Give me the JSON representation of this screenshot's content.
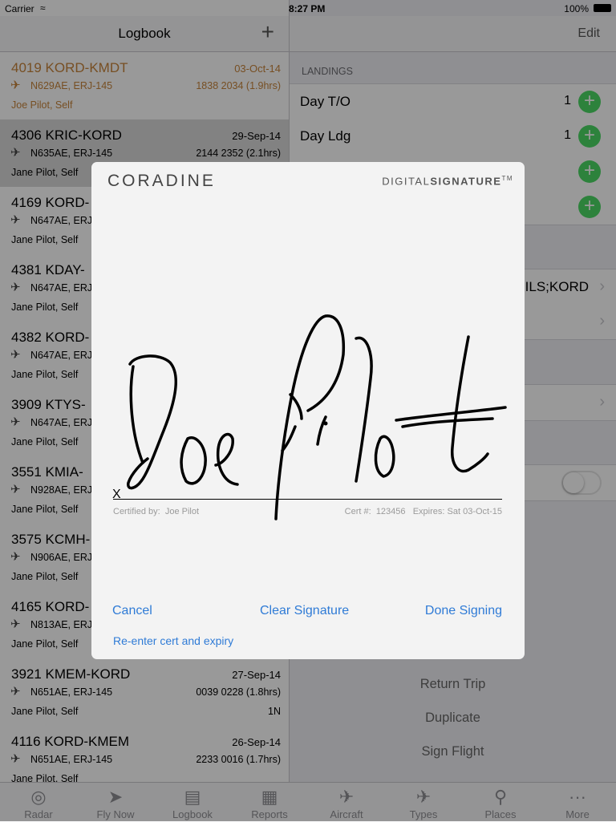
{
  "status": {
    "carrier": "Carrier",
    "time": "8:27 PM",
    "battery": "100%"
  },
  "left": {
    "title": "Logbook",
    "add": "+",
    "flights": [
      {
        "route": "4019 KORD-KMDT",
        "date": "03-Oct-14",
        "aircraft": "N629AE, ERJ-145",
        "times": "1838 2034 (1.9hrs)",
        "crew": "Joe Pilot, Self",
        "extra": ""
      },
      {
        "route": "4306 KRIC-KORD",
        "date": "29-Sep-14",
        "aircraft": "N635AE, ERJ-145",
        "times": "2144 2352 (2.1hrs)",
        "crew": "Jane Pilot, Self",
        "extra": ""
      },
      {
        "route": "4169 KORD-",
        "date": "",
        "aircraft": "N647AE, ERJ",
        "times": "",
        "crew": "Jane Pilot, Self",
        "extra": ""
      },
      {
        "route": "4381 KDAY-",
        "date": "",
        "aircraft": "N647AE, ERJ",
        "times": "",
        "crew": "Jane Pilot, Self",
        "extra": ""
      },
      {
        "route": "4382 KORD-",
        "date": "",
        "aircraft": "N647AE, ERJ",
        "times": "",
        "crew": "Jane Pilot, Self",
        "extra": ""
      },
      {
        "route": "3909 KTYS-",
        "date": "",
        "aircraft": "N647AE, ERJ",
        "times": "",
        "crew": "Jane Pilot, Self",
        "extra": ""
      },
      {
        "route": "3551 KMIA-",
        "date": "",
        "aircraft": "N928AE, ERJ",
        "times": "",
        "crew": "Jane Pilot, Self",
        "extra": ""
      },
      {
        "route": "3575 KCMH-",
        "date": "",
        "aircraft": "N906AE, ERJ",
        "times": "",
        "crew": "Jane Pilot, Self",
        "extra": ""
      },
      {
        "route": "4165 KORD-",
        "date": "",
        "aircraft": "N813AE, ERJ",
        "times": "",
        "crew": "Jane Pilot, Self",
        "extra": ""
      },
      {
        "route": "3921 KMEM-KORD",
        "date": "27-Sep-14",
        "aircraft": "N651AE, ERJ-145",
        "times": "0039 0228 (1.8hrs)",
        "crew": "Jane Pilot, Self",
        "extra": "1N"
      },
      {
        "route": "4116 KORD-KMEM",
        "date": "26-Sep-14",
        "aircraft": "N651AE, ERJ-145",
        "times": "2233 0016 (1.7hrs)",
        "crew": "Jane Pilot, Self",
        "extra": ""
      }
    ]
  },
  "right": {
    "edit": "Edit",
    "landings_header": "LANDINGS",
    "day_to": {
      "label": "Day T/O",
      "count": "1"
    },
    "day_ldg": {
      "label": "Day Ldg",
      "count": "1"
    },
    "approach_value": "ILS;KORD",
    "actions": [
      "Return Trip",
      "Duplicate",
      "Sign Flight"
    ]
  },
  "modal": {
    "brand": "CORADINE",
    "product_light": "DIGITAL",
    "product_bold": "SIGNATURE",
    "tm": "TM",
    "x": "X",
    "certified_label": "Certified by:",
    "certified_name": "Joe Pilot",
    "cert_label": "Cert #:",
    "cert_number": "123456",
    "expires_label": "Expires:",
    "expires_value": "Sat 03-Oct-15",
    "cancel": "Cancel",
    "clear": "Clear Signature",
    "done": "Done Signing",
    "reenter": "Re-enter cert and expiry"
  },
  "tabs": [
    {
      "label": "Radar",
      "icon": "radar-icon"
    },
    {
      "label": "Fly Now",
      "icon": "rocket-icon"
    },
    {
      "label": "Logbook",
      "icon": "logbook-icon"
    },
    {
      "label": "Reports",
      "icon": "reports-icon"
    },
    {
      "label": "Aircraft",
      "icon": "aircraft-icon"
    },
    {
      "label": "Types",
      "icon": "types-icon"
    },
    {
      "label": "Places",
      "icon": "places-icon"
    },
    {
      "label": "More",
      "icon": "more-icon"
    }
  ],
  "colors": {
    "accent": "#2f7bd6",
    "highlight": "#c7843b",
    "add_green": "#4cd964"
  }
}
